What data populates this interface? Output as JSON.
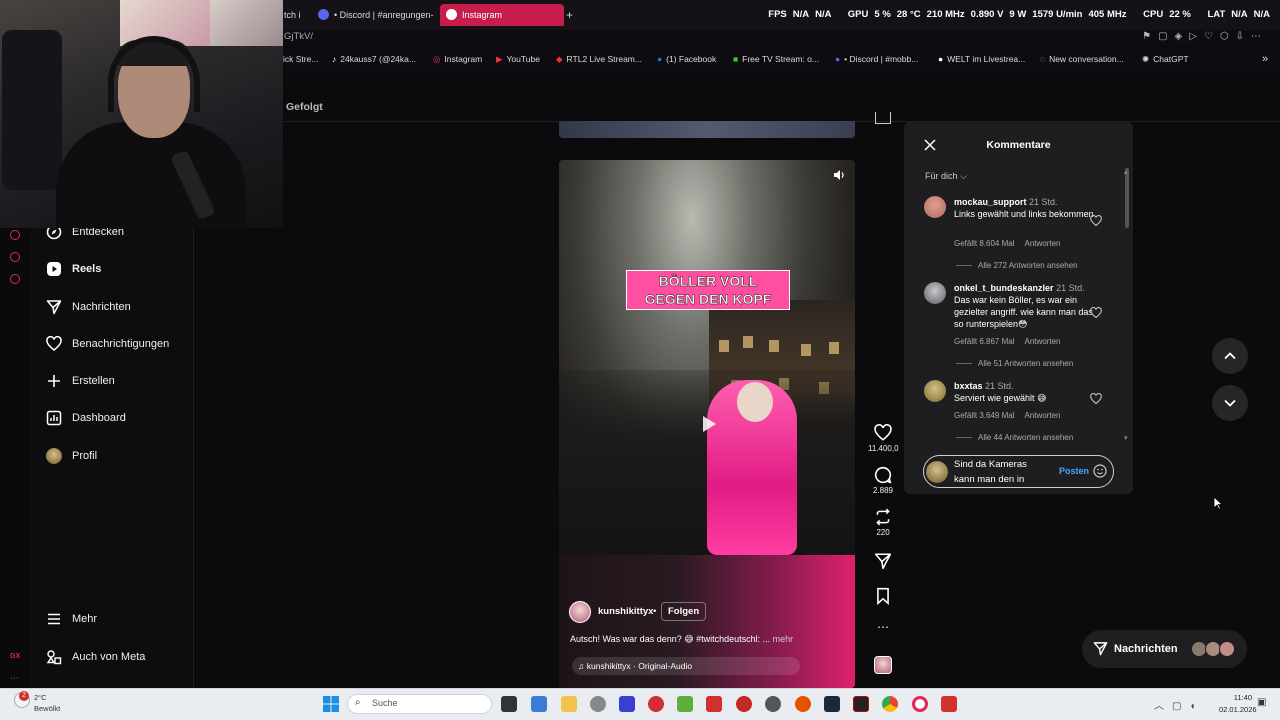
{
  "browser": {
    "tabs": [
      {
        "label": "tch i",
        "color": "#9146ff"
      },
      {
        "label": "• Discord | #anregungen-",
        "color": "#5865f2"
      },
      {
        "label": "Instagram",
        "color": "#e1306c",
        "active": true
      }
    ],
    "url": "GjTkV/",
    "bookmarks": [
      {
        "label": "ick Stre..."
      },
      {
        "label": "24kauss7 (@24ka..."
      },
      {
        "label": "Instagram"
      },
      {
        "label": "YouTube"
      },
      {
        "label": "RTL2 Live Stream..."
      },
      {
        "label": "(1) Facebook"
      },
      {
        "label": "Free TV Stream: o..."
      },
      {
        "label": "• Discord | #mobb..."
      },
      {
        "label": "WELT im Livestrea..."
      },
      {
        "label": "New conversation..."
      },
      {
        "label": "ChatGPT"
      }
    ],
    "osd": {
      "fps_label": "FPS",
      "fps_a": "N/A",
      "fps_b": "N/A",
      "gpu_label": "GPU",
      "gpu_pct": "5 %",
      "gpu_temp": "28 °C",
      "gpu_clock": "210 MHz",
      "gpu_volt": "0.890 V",
      "gpu_power": "9 W",
      "gpu_fan": "1579 U/min",
      "gpu_mem": "405 MHz",
      "cpu_label": "CPU",
      "cpu_pct": "22 %",
      "lat_label": "LAT",
      "lat_a": "N/A",
      "lat_b": "N/A"
    }
  },
  "sidebar": {
    "items": [
      {
        "label": "Entdecken",
        "icon": "compass-icon"
      },
      {
        "label": "Reels",
        "icon": "reels-icon",
        "active": true
      },
      {
        "label": "Nachrichten",
        "icon": "send-icon"
      },
      {
        "label": "Benachrichtigungen",
        "icon": "heart-icon"
      },
      {
        "label": "Erstellen",
        "icon": "plus-icon"
      },
      {
        "label": "Dashboard",
        "icon": "dashboard-icon"
      },
      {
        "label": "Profil",
        "icon": "avatar"
      }
    ],
    "more": "Mehr",
    "meta": "Auch von Meta"
  },
  "feed": {
    "following_label": "Gefolgt"
  },
  "reel": {
    "overlay_text": "BÖLLER VOLL GEGEN DEN KOPF",
    "username": "kunshikittyx",
    "follow_label": "Folgen",
    "caption": "Autsch! Was war das denn? 😅 #twitchdeutschl: ...",
    "more_label": "mehr",
    "audio": "kunshikittyx · Original-Audio",
    "actions": {
      "likes": "11.400,0",
      "comments": "2.889",
      "reposts": "220"
    }
  },
  "comments": {
    "title": "Kommentare",
    "sort": "Für dich",
    "items": [
      {
        "user": "mockau_support",
        "time": "21 Std.",
        "text": "Links gewählt und links bekommen",
        "likes": "Gefällt 8.604 Mal",
        "reply": "Antworten",
        "replies": "Alle 272 Antworten ansehen",
        "avatar_color": "#b06a5a"
      },
      {
        "user": "onkel_t_bundeskanzler",
        "time": "21 Std.",
        "text": "Das war kein Böller, es war ein gezielter angriff. wie kann man das so runterspielen😳",
        "likes": "Gefällt 6.867 Mal",
        "reply": "Antworten",
        "replies": "Alle 51 Antworten ansehen",
        "avatar_color": "#7a7f86"
      },
      {
        "user": "bxxtas",
        "time": "21 Std.",
        "text": "Serviert wie gewählt 😅",
        "likes": "Gefällt 3.649 Mal",
        "reply": "Antworten",
        "replies": "Alle 44 Antworten ansehen",
        "avatar_color": "#9a8a50"
      }
    ],
    "input_text": "Sind da Kameras kann man den in",
    "post_label": "Posten"
  },
  "messages_pill": {
    "label": "Nachrichten"
  },
  "taskbar": {
    "weather_temp": "2°C",
    "weather_desc": "Bewölkt",
    "weather_badge": "2",
    "search_placeholder": "Suche",
    "time": "11:40",
    "date": "02.01.2026"
  },
  "colors": {
    "accent": "#e1306c",
    "link": "#4aa3ff",
    "panel": "#1e1e20",
    "reel_pink": "#ff4fa0"
  }
}
